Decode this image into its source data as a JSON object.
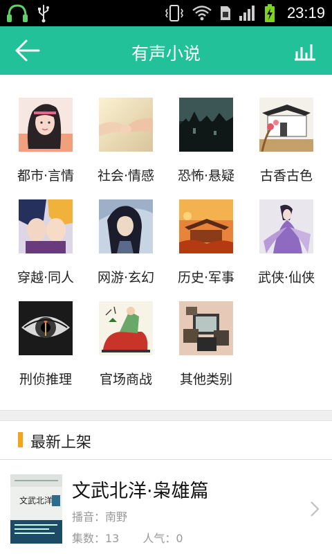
{
  "status_bar": {
    "time": "23:19"
  },
  "header": {
    "title": "有声小说"
  },
  "categories": [
    {
      "label": "都市·言情"
    },
    {
      "label": "社会·情感"
    },
    {
      "label": "恐怖·悬疑"
    },
    {
      "label": "古香古色"
    },
    {
      "label": "穿越·同人"
    },
    {
      "label": "网游·玄幻"
    },
    {
      "label": "历史·军事"
    },
    {
      "label": "武侠·仙侠"
    },
    {
      "label": "刑侦推理"
    },
    {
      "label": "官场商战"
    },
    {
      "label": "其他类别"
    }
  ],
  "section": {
    "title": "最新上架"
  },
  "book": {
    "title": "文武北洋·枭雄篇",
    "narrator": "播音：南野",
    "episodes": "集数：13",
    "popularity": "人气：0",
    "cover_text": "文武北洋"
  },
  "colors": {
    "accent": "#22c19a",
    "section_mark": "#f4a41c"
  }
}
